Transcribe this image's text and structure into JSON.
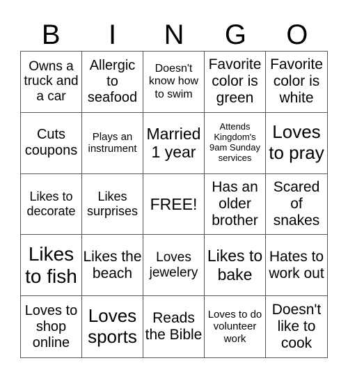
{
  "header": [
    "B",
    "I",
    "N",
    "G",
    "O"
  ],
  "cells": [
    "Owns a truck and a car",
    "Allergic to seafood",
    "Doesn't know how to swim",
    "Favorite color is green",
    "Favorite color is white",
    "Cuts coupons",
    "Plays an instrument",
    "Married 1 year",
    "Attends Kingdom's 9am Sunday services",
    "Loves to pray",
    "Likes to decorate",
    "Likes surprises",
    "FREE!",
    "Has an older brother",
    "Scared of snakes",
    "Likes to fish",
    "Likes the beach",
    "Loves jewelery",
    "Likes to bake",
    "Hates to work out",
    "Loves to shop online",
    "Loves sports",
    "Reads the Bible",
    "Loves to do volunteer work",
    "Doesn't like to cook"
  ]
}
